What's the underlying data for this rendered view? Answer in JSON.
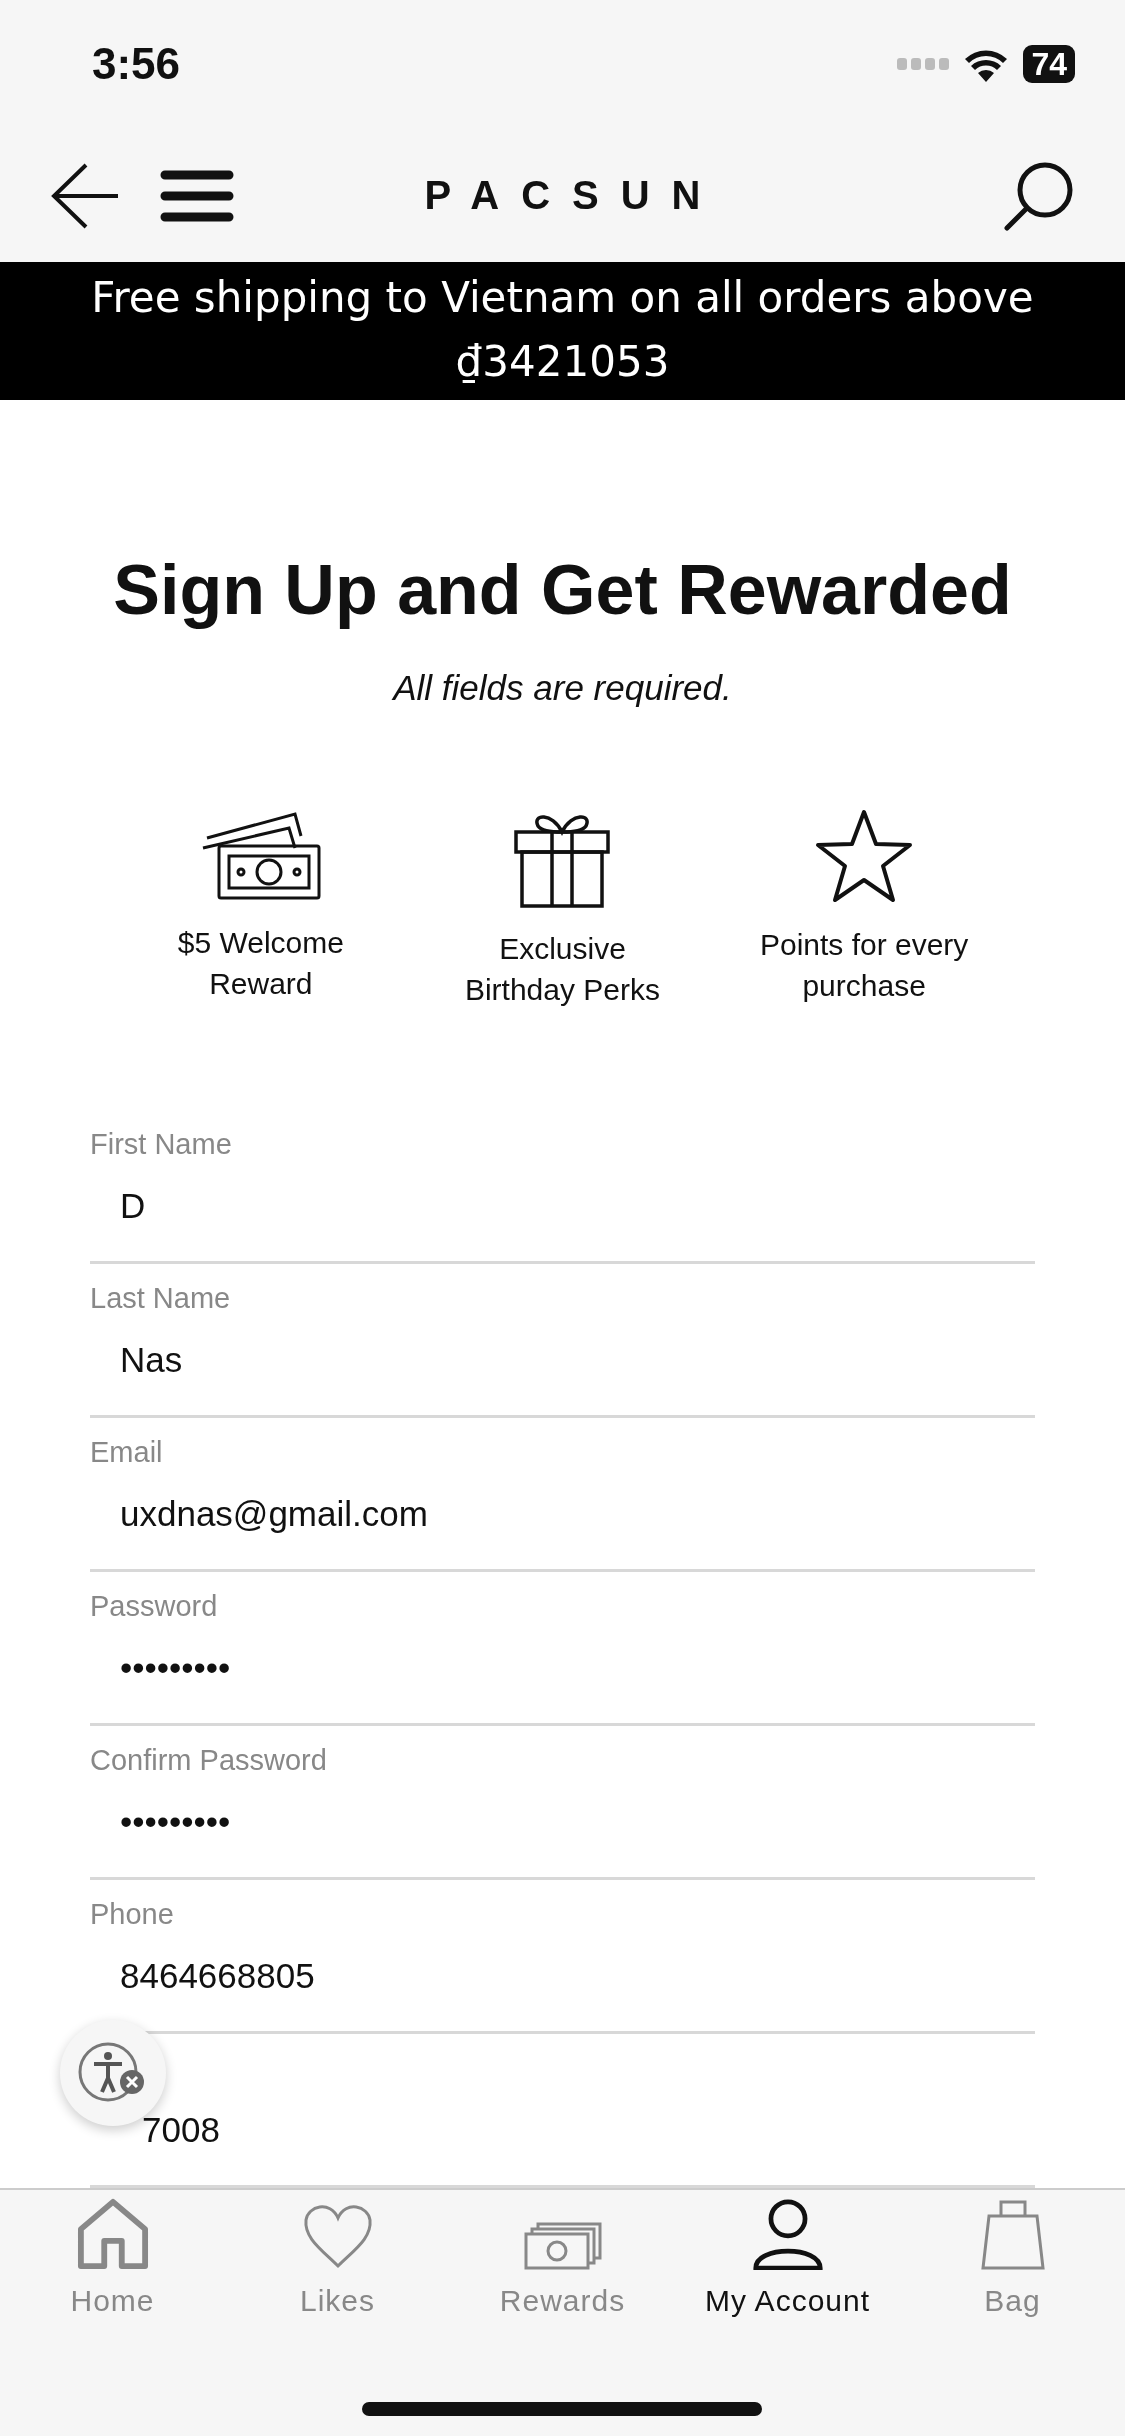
{
  "status_bar": {
    "time": "3:56",
    "battery": "74"
  },
  "nav": {
    "logo": "PACSUN"
  },
  "banner": {
    "text": "Free shipping to Vietnam on all orders above ₫3421053"
  },
  "title": "Sign Up and Get Rewarded",
  "subtitle": "All fields are required.",
  "perks": [
    {
      "kind": "money",
      "label": "$5 Welcome Reward"
    },
    {
      "kind": "gift",
      "label": "Exclusive Birthday Perks"
    },
    {
      "kind": "star",
      "label": "Points for every purchase"
    }
  ],
  "fields": [
    {
      "label": "First Name",
      "value": "D"
    },
    {
      "label": "Last Name",
      "value": "Nas"
    },
    {
      "label": "Email",
      "value": "uxdnas@gmail.com"
    },
    {
      "label": "Password",
      "value": "•••••••••"
    },
    {
      "label": "Confirm Password",
      "value": "•••••••••"
    },
    {
      "label": "Phone",
      "value": "8464668805"
    },
    {
      "value": "7008"
    }
  ],
  "tabs": [
    {
      "kind": "home",
      "label": "Home",
      "selected": false
    },
    {
      "kind": "heart",
      "label": "Likes",
      "selected": false
    },
    {
      "kind": "money",
      "label": "Rewards",
      "selected": false
    },
    {
      "kind": "person",
      "label": "My Account",
      "selected": true
    },
    {
      "kind": "bag",
      "label": "Bag",
      "selected": false
    }
  ]
}
